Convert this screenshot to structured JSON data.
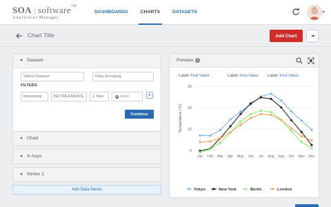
{
  "header": {
    "logo_soa": "SOA",
    "logo_software": "software",
    "logo_tm": "TM",
    "logo_sub": "Analytical Manager",
    "nav": [
      {
        "label": "DASHBOARDS",
        "active": false
      },
      {
        "label": "CHARTS",
        "active": true
      },
      {
        "label": "DATASETS",
        "active": false
      }
    ]
  },
  "subheader": {
    "title": "Chart Title",
    "add_chart": "Add Chart"
  },
  "dataset": {
    "heading": "Dataset",
    "select_dataset_placeholder": "Select Dataset",
    "data_grouping_placeholder": "Data Grouping",
    "filters_label": "FILTERS",
    "filter_field": "timestamp",
    "filter_operator": "BETWEENDATE",
    "filter_value": "1 Year",
    "filter_label": "label",
    "add_filter": "+",
    "continue": "Continue"
  },
  "sections": [
    {
      "label": "Chart"
    },
    {
      "label": "X-Axys"
    },
    {
      "label": "Series 1"
    }
  ],
  "add_series": "Add Data Series",
  "preview": {
    "heading": "Preview",
    "info_glyph": "i",
    "labels": [
      {
        "prefix": "Label:",
        "value": "First Value"
      },
      {
        "prefix": "Label:",
        "value": "First Value"
      },
      {
        "prefix": "Label:",
        "value": "First Value"
      }
    ]
  },
  "chart_data": {
    "type": "line",
    "categories": [
      "Jan",
      "Feb",
      "Mar",
      "Apr",
      "May",
      "Jun",
      "Jul",
      "Aug",
      "Sep",
      "Oct",
      "Nov",
      "Dec"
    ],
    "ylabel": "Temperature (°C)",
    "ylim": [
      0,
      30
    ],
    "yticks": [
      0,
      10,
      20,
      30
    ],
    "grid": true,
    "legend_position": "bottom",
    "series": [
      {
        "name": "Tokyo",
        "color": "#7cb5ec",
        "values": [
          7.0,
          6.9,
          9.5,
          14.5,
          18.2,
          21.5,
          25.2,
          26.5,
          23.3,
          18.3,
          13.9,
          9.6
        ]
      },
      {
        "name": "New York",
        "color": "#222222",
        "values": [
          -0.2,
          0.8,
          5.7,
          11.3,
          17.0,
          22.0,
          24.8,
          24.1,
          20.1,
          14.1,
          8.6,
          2.5
        ]
      },
      {
        "name": "Berlin",
        "color": "#90ed7d",
        "values": [
          -0.9,
          0.6,
          3.5,
          8.4,
          13.5,
          17.0,
          18.6,
          17.9,
          14.3,
          9.0,
          3.9,
          1.0
        ]
      },
      {
        "name": "London",
        "color": "#f7a35c",
        "values": [
          3.9,
          4.2,
          5.7,
          8.5,
          11.9,
          15.2,
          17.0,
          16.6,
          14.2,
          10.3,
          6.6,
          4.8
        ]
      }
    ]
  }
}
